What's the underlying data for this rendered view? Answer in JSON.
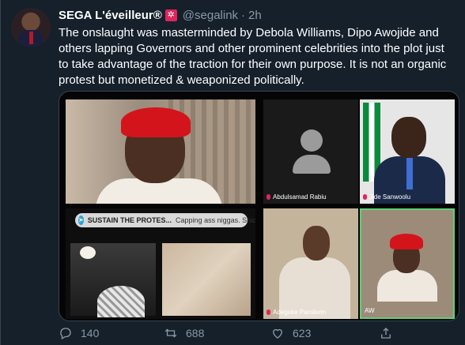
{
  "tweet": {
    "author_name": "SEGA L'éveilleur®",
    "badge_glyph": "✲",
    "handle": "@segalink",
    "separator": "·",
    "time": "2h",
    "text": "The onslaught was masterminded by Debola Williams, Dipo Awojide and others lapping Governors and other prominent celebrities into the plot just to take advantage of the traction for their own purpose. It is not an organic protest but monetized & weaponized politically."
  },
  "media": {
    "telegram_glyph": "➤",
    "telegram_title": "SUSTAIN THE PROTES...",
    "telegram_message": "Capping ass niggas. Shior",
    "participants": [
      {
        "name": "Abdulsamad Rabiu"
      },
      {
        "name": "Jide Sanwoolu"
      },
      {
        "name": "Adegoke Pamilerin"
      },
      {
        "name": "AW"
      }
    ]
  },
  "actions": {
    "reply_count": "140",
    "retweet_count": "688",
    "like_count": "623",
    "icons": [
      "reply-icon",
      "retweet-icon",
      "like-icon",
      "share-icon"
    ]
  },
  "colors": {
    "background": "#15202b",
    "muted": "#8899a6",
    "badge": "#e0245e",
    "active_speaker": "#5fd07a"
  }
}
